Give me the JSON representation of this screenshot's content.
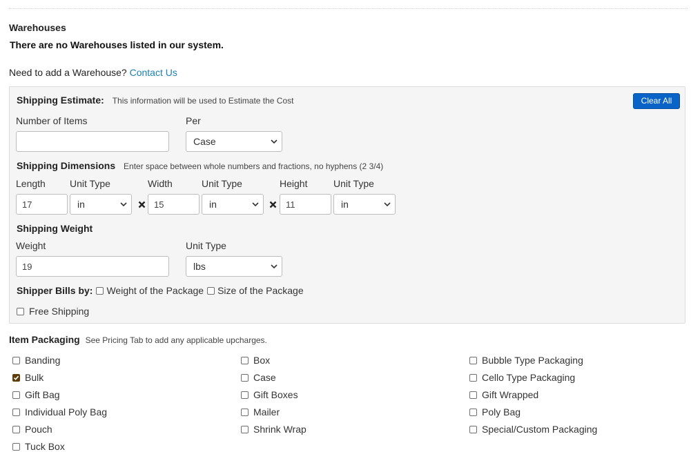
{
  "warehouses": {
    "title": "Warehouses",
    "empty_message": "There are no Warehouses listed in our system.",
    "need_text": "Need to add a Warehouse?",
    "contact_link": "Contact Us"
  },
  "shipping_estimate": {
    "title": "Shipping Estimate:",
    "note": "This information will be used to Estimate the Cost",
    "clear_all_label": "Clear All",
    "items_label": "Number of Items",
    "items_value": "",
    "per_label": "Per",
    "per_value": "Case"
  },
  "dimensions": {
    "title": "Shipping Dimensions",
    "note": "Enter space between whole numbers and fractions, no hyphens (2 3/4)",
    "length_label": "Length",
    "length_value": "17",
    "length_unit_label": "Unit Type",
    "length_unit": "in",
    "width_label": "Width",
    "width_value": "15",
    "width_unit_label": "Unit Type",
    "width_unit": "in",
    "height_label": "Height",
    "height_value": "11",
    "height_unit_label": "Unit Type",
    "height_unit": "in"
  },
  "weight": {
    "title": "Shipping Weight",
    "weight_label": "Weight",
    "weight_value": "19",
    "unit_label": "Unit Type",
    "unit_value": "lbs"
  },
  "bills_by": {
    "label": "Shipper Bills by:",
    "weight_option": "Weight of the Package",
    "weight_checked": false,
    "size_option": "Size of the Package",
    "size_checked": false
  },
  "free_shipping": {
    "label": "Free Shipping",
    "checked": false
  },
  "packaging": {
    "title": "Item Packaging",
    "note": "See Pricing Tab to add any applicable upcharges.",
    "options": [
      {
        "label": "Banding",
        "checked": false
      },
      {
        "label": "Box",
        "checked": false
      },
      {
        "label": "Bubble Type Packaging",
        "checked": false
      },
      {
        "label": "Bulk",
        "checked": true
      },
      {
        "label": "Case",
        "checked": false
      },
      {
        "label": "Cello Type Packaging",
        "checked": false
      },
      {
        "label": "Gift Bag",
        "checked": false
      },
      {
        "label": "Gift Boxes",
        "checked": false
      },
      {
        "label": "Gift Wrapped",
        "checked": false
      },
      {
        "label": "Individual Poly Bag",
        "checked": false
      },
      {
        "label": "Mailer",
        "checked": false
      },
      {
        "label": "Poly Bag",
        "checked": false
      },
      {
        "label": "Pouch",
        "checked": false
      },
      {
        "label": "Shrink Wrap",
        "checked": false
      },
      {
        "label": "Special/Custom Packaging",
        "checked": false
      },
      {
        "label": "Tuck Box",
        "checked": false
      }
    ]
  },
  "colors": {
    "link": "#1a7fb5",
    "button": "#0a63c7",
    "checked": "#5c3d0a",
    "panel_bg": "#f5f5f5"
  }
}
